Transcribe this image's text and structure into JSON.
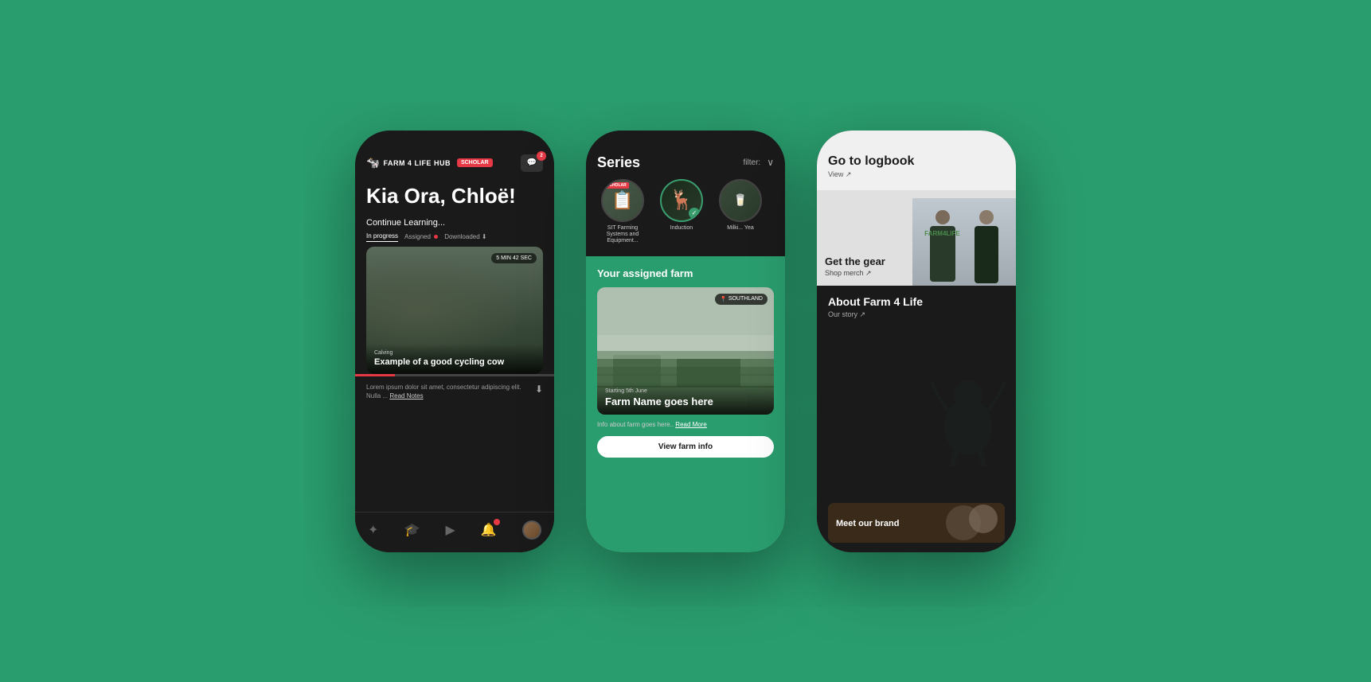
{
  "background_color": "#2a9d6e",
  "phone1": {
    "header": {
      "logo_text": "FARM 4 LIFE HUB",
      "scholar_badge": "SCHOLAR",
      "chat_badge": "2"
    },
    "greeting": "Kia Ora, Chloë!",
    "continue_learning": "Continue Learning...",
    "tabs": {
      "in_progress": "In progress",
      "assigned": "Assigned",
      "downloaded": "Downloaded"
    },
    "video": {
      "timer": "5 MIN 42 SEC",
      "category": "Calving",
      "title": "Example of a good cycling cow"
    },
    "description": "Lorem ipsum dolor sit amet, consectetur adipiscing elit. Nulla ...",
    "read_notes": "Read Notes",
    "nav": {
      "explore": "✕",
      "learn": "🎓",
      "play": "▶",
      "notifications": "🔔"
    }
  },
  "phone2": {
    "header": {
      "title": "Series",
      "filter": "filter:",
      "chevron": "∨"
    },
    "series": [
      {
        "label": "SIT Farming Systems and Equipment...",
        "scholar": "SCHOLAR",
        "has_badge": false
      },
      {
        "label": "Induction",
        "active": true,
        "has_badge": true
      },
      {
        "label": "Milki... Yea",
        "has_badge": false
      }
    ],
    "farm_section": {
      "title": "Your assigned farm",
      "location": "SOUTHLAND",
      "date": "Starting 5th June",
      "farm_name": "Farm Name goes here",
      "info": "Info about farm goes here..",
      "read_more": "Read More",
      "view_btn": "View farm info"
    }
  },
  "phone3": {
    "logbook": {
      "title": "Go to logbook",
      "link": "View ↗"
    },
    "gear": {
      "title": "Get the gear",
      "link": "Shop merch ↗"
    },
    "about": {
      "title": "About Farm 4 Life",
      "link": "Our story ↗"
    },
    "meet": {
      "title": "Meet our brand"
    }
  }
}
